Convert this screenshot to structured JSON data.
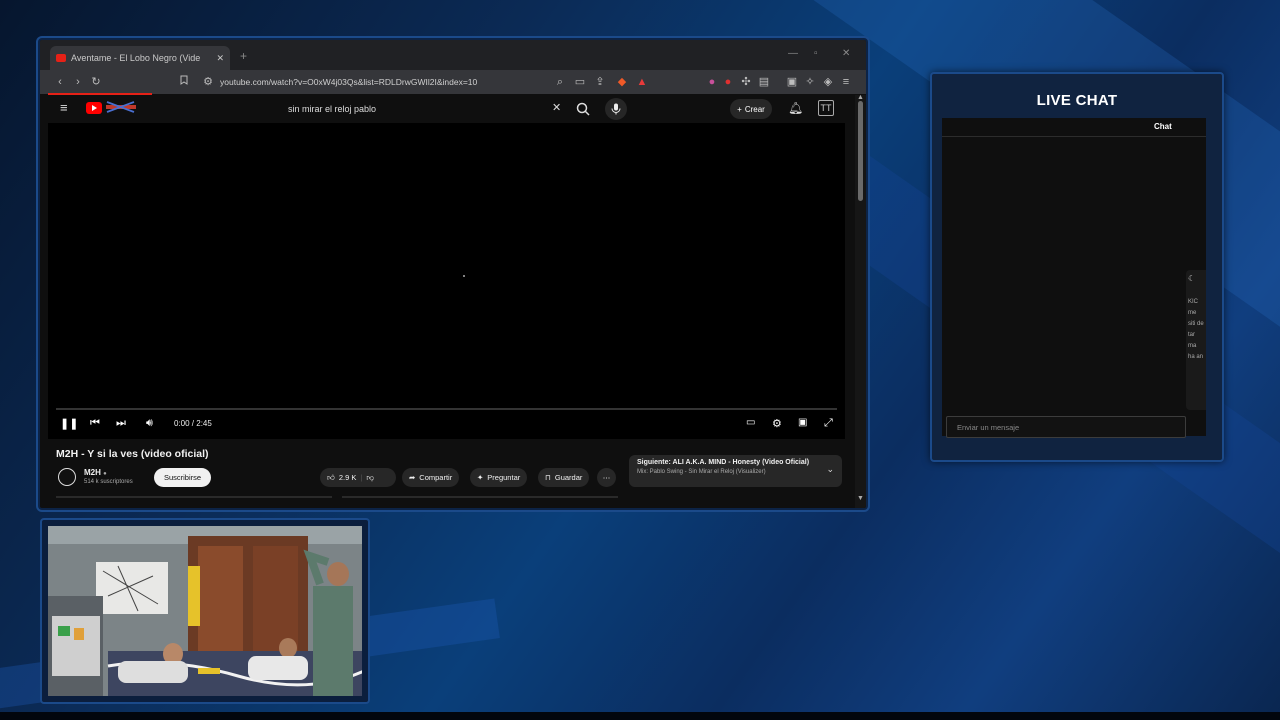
{
  "browser": {
    "tab_title": "Aventame - El Lobo Negro (Vide",
    "url": "youtube.com/watch?v=O0xW4j03Qs&list=RDLDrwGWIl2I&index=10"
  },
  "youtube": {
    "search_query": "sin mirar el reloj pablo",
    "create_label": "Crear",
    "avatar_initials": "TT",
    "time": "0:00 / 2:45",
    "video_title": "M2H - Y si la ves (video oficial)",
    "channel_name": "M2H",
    "channel_subs": "514 k suscriptores",
    "subscribe_label": "Suscribirse",
    "like_count": "2.9 K",
    "share_label": "Compartir",
    "ask_label": "Preguntar",
    "save_label": "Guardar",
    "next_title": "Siguiente: ALI A.K.A. MIND - Honesty (Video Oficial)",
    "next_sub": "Mix: Pablo Swing - Sin Mirar el Reloj (Visualizer)"
  },
  "chat": {
    "heading": "LIVE CHAT",
    "tab_label": "Chat",
    "side_text": "KIC me siti de tar ma ha an",
    "input_placeholder": "Enviar un mensaje"
  },
  "colors": {
    "yt_red": "#ff0000",
    "frame_blue": "#1b4a8a",
    "panel_bg": "#0f0f0f"
  }
}
